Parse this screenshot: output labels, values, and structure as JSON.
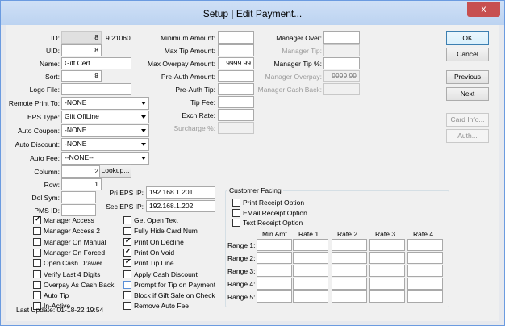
{
  "window": {
    "title": "Setup | Edit Payment...",
    "close_glyph": "x"
  },
  "col1": {
    "id_label": "ID:",
    "id_value": "8",
    "id_extra": "9.21060",
    "uid_label": "UID:",
    "uid_value": "8",
    "name_label": "Name:",
    "name_value": "Gift Cert",
    "sort_label": "Sort:",
    "sort_value": "8",
    "logo_label": "Logo File:",
    "logo_value": "",
    "remote_label": "Remote Print To:",
    "remote_value": "-NONE",
    "eps_label": "EPS Type:",
    "eps_value": "Gift OffLine",
    "coupon_label": "Auto Coupon:",
    "coupon_value": "-NONE",
    "discount_label": "Auto Discount:",
    "discount_value": "-NONE",
    "fee_label": "Auto Fee:",
    "fee_value": "--NONE--",
    "column_label": "Column:",
    "column_value": "2",
    "lookup_label": "Lookup...",
    "row_label": "Row:",
    "row_value": "1",
    "dol_label": "Dol Sym:",
    "dol_value": "",
    "pms_label": "PMS ID:",
    "pms_value": ""
  },
  "col2": {
    "min_label": "Minimum Amount:",
    "min_value": "",
    "maxtip_label": "Max Tip Amount:",
    "maxtip_value": "",
    "maxover_label": "Max Overpay Amount:",
    "maxover_value": "9999.99",
    "preauth_label": "Pre-Auth Amount:",
    "preauth_value": "",
    "preauthtip_label": "Pre-Auth Tip:",
    "preauthtip_value": "",
    "tipfee_label": "Tip Fee:",
    "tipfee_value": "",
    "exch_label": "Exch Rate:",
    "exch_value": "",
    "surcharge_label": "Surcharge %:",
    "surcharge_value": ""
  },
  "col3": {
    "mgrover_label": "Manager Over:",
    "mgrover_value": "",
    "mgrtip_label": "Manager Tip:",
    "mgrtip_value": "",
    "mgrtippct_label": "Manager Tip %:",
    "mgrtippct_value": "",
    "mgroverpay_label": "Manager Overpay:",
    "mgroverpay_value": "9999.99",
    "mgrcashback_label": "Manager Cash Back:",
    "mgrcashback_value": ""
  },
  "buttons": {
    "ok": "OK",
    "cancel": "Cancel",
    "previous": "Previous",
    "next": "Next",
    "cardinfo": "Card Info...",
    "auth": "Auth..."
  },
  "ips": {
    "pri_label": "Pri EPS IP:",
    "pri_value": "192.168.1.201",
    "sec_label": "Sec EPS IP:",
    "sec_value": "192.168.1.202"
  },
  "checks_left": [
    {
      "label": "Manager Access",
      "checked": true
    },
    {
      "label": "Manager Access 2",
      "checked": false
    },
    {
      "label": "Manager On Manual",
      "checked": false
    },
    {
      "label": "Manager On Forced",
      "checked": false
    },
    {
      "label": "Open Cash Drawer",
      "checked": false
    },
    {
      "label": "Verify Last 4 Digits",
      "checked": false
    },
    {
      "label": "Overpay As Cash Back",
      "checked": false
    },
    {
      "label": "Auto Tip",
      "checked": false
    },
    {
      "label": "In-Active",
      "checked": false
    }
  ],
  "checks_mid": [
    {
      "label": "Get Open Text",
      "checked": false
    },
    {
      "label": "Fully Hide Card Num",
      "checked": false
    },
    {
      "label": "Print On Decline",
      "checked": true
    },
    {
      "label": "Print On Void",
      "checked": true
    },
    {
      "label": "Print Tip Line",
      "checked": true
    },
    {
      "label": "Apply Cash Discount",
      "checked": false
    },
    {
      "label": "Prompt for Tip on Payment",
      "checked": false
    },
    {
      "label": "Block if Gift Sale on Check",
      "checked": false
    },
    {
      "label": "Remove Auto Fee",
      "checked": false
    }
  ],
  "customer": {
    "title": "Customer Facing",
    "options": [
      {
        "label": "Print Receipt Option",
        "checked": false
      },
      {
        "label": "EMail Receipt Option",
        "checked": false
      },
      {
        "label": "Text Receipt Option",
        "checked": false
      }
    ],
    "headers": [
      "Min Amt",
      "Rate 1",
      "Rate 2",
      "Rate 3",
      "Rate 4"
    ],
    "ranges": [
      "Range 1:",
      "Range 2:",
      "Range 3:",
      "Range 4:",
      "Range 5:"
    ]
  },
  "footer": {
    "last_update": "Last Update:  01-18-22 19:54"
  }
}
